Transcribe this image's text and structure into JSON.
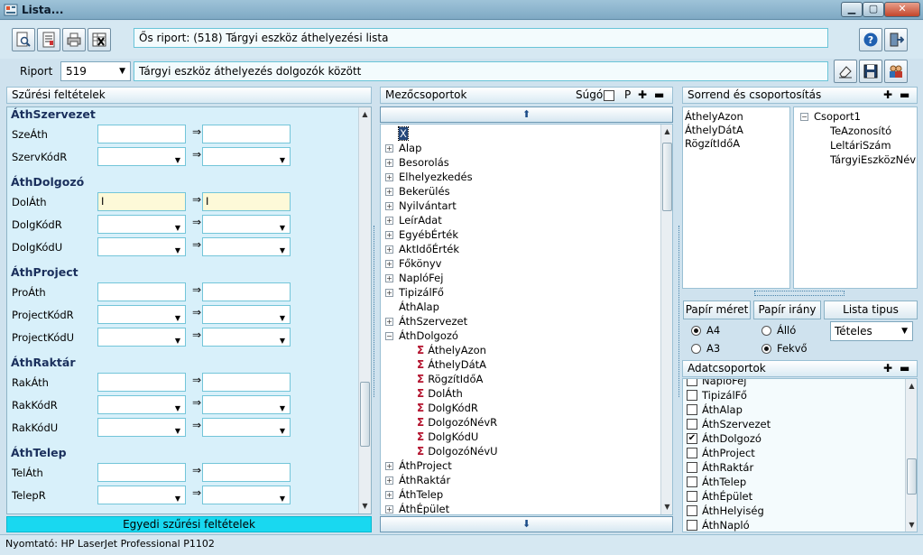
{
  "window": {
    "title": "Lista..."
  },
  "header": {
    "parent_report": "Ős riport: (518)  Tárgyi eszköz áthelyezési lista",
    "riport_label": "Riport",
    "riport_value": "519",
    "riport_desc": "Tárgyi eszköz áthelyezés dolgozók között"
  },
  "filter": {
    "title": "Szűrési feltételek",
    "footer_button": "Egyedi szűrési feltételek",
    "groups": [
      {
        "name": "ÁthSzervezet",
        "rows": [
          {
            "label": "SzeÁth",
            "type": "text",
            "from": "",
            "to": ""
          },
          {
            "label": "SzervKódR",
            "type": "select",
            "from": "",
            "to": ""
          }
        ]
      },
      {
        "name": "ÁthDolgozó",
        "rows": [
          {
            "label": "DolÁth",
            "type": "text",
            "from": "I",
            "to": "I"
          },
          {
            "label": "DolgKódR",
            "type": "select",
            "from": "",
            "to": ""
          },
          {
            "label": "DolgKódU",
            "type": "select",
            "from": "",
            "to": ""
          }
        ]
      },
      {
        "name": "ÁthProject",
        "rows": [
          {
            "label": "ProÁth",
            "type": "text",
            "from": "",
            "to": ""
          },
          {
            "label": "ProjectKódR",
            "type": "select",
            "from": "",
            "to": ""
          },
          {
            "label": "ProjectKódU",
            "type": "select",
            "from": "",
            "to": ""
          }
        ]
      },
      {
        "name": "ÁthRaktár",
        "rows": [
          {
            "label": "RakÁth",
            "type": "text",
            "from": "",
            "to": ""
          },
          {
            "label": "RakKódR",
            "type": "select",
            "from": "",
            "to": ""
          },
          {
            "label": "RakKódU",
            "type": "select",
            "from": "",
            "to": ""
          }
        ]
      },
      {
        "name": "ÁthTelep",
        "rows": [
          {
            "label": "TelÁth",
            "type": "text",
            "from": "",
            "to": ""
          },
          {
            "label": "TelepR",
            "type": "select",
            "from": "",
            "to": ""
          }
        ]
      }
    ]
  },
  "fields": {
    "title": "Mezőcsoportok",
    "help_label": "Súgó",
    "p_label": "P",
    "tree": [
      {
        "t": "X",
        "lvl": 0,
        "kind": "sel"
      },
      {
        "t": "Alap",
        "lvl": 0,
        "kind": "plus"
      },
      {
        "t": "Besorolás",
        "lvl": 0,
        "kind": "plus"
      },
      {
        "t": "Elhelyezkedés",
        "lvl": 0,
        "kind": "plus"
      },
      {
        "t": "Bekerülés",
        "lvl": 0,
        "kind": "plus"
      },
      {
        "t": "Nyilvántart",
        "lvl": 0,
        "kind": "plus"
      },
      {
        "t": "LeírAdat",
        "lvl": 0,
        "kind": "plus"
      },
      {
        "t": "EgyébÉrték",
        "lvl": 0,
        "kind": "plus"
      },
      {
        "t": "AktIdőÉrték",
        "lvl": 0,
        "kind": "plus"
      },
      {
        "t": "Főkönyv",
        "lvl": 0,
        "kind": "plus"
      },
      {
        "t": "NaplóFej",
        "lvl": 0,
        "kind": "plus"
      },
      {
        "t": "TipizálFő",
        "lvl": 0,
        "kind": "plus"
      },
      {
        "t": "ÁthAlap",
        "lvl": 0,
        "kind": "none"
      },
      {
        "t": "ÁthSzervezet",
        "lvl": 0,
        "kind": "plus"
      },
      {
        "t": "ÁthDolgozó",
        "lvl": 0,
        "kind": "minus"
      },
      {
        "t": "ÁthelyAzon",
        "lvl": 1,
        "kind": "sig"
      },
      {
        "t": "ÁthelyDátA",
        "lvl": 1,
        "kind": "sig"
      },
      {
        "t": "RögzítIdőA",
        "lvl": 1,
        "kind": "sig"
      },
      {
        "t": "DolÁth",
        "lvl": 1,
        "kind": "sig"
      },
      {
        "t": "DolgKódR",
        "lvl": 1,
        "kind": "sig"
      },
      {
        "t": "DolgozóNévR",
        "lvl": 1,
        "kind": "sig"
      },
      {
        "t": "DolgKódU",
        "lvl": 1,
        "kind": "sig"
      },
      {
        "t": "DolgozóNévU",
        "lvl": 1,
        "kind": "sig"
      },
      {
        "t": "ÁthProject",
        "lvl": 0,
        "kind": "plus"
      },
      {
        "t": "ÁthRaktár",
        "lvl": 0,
        "kind": "plus"
      },
      {
        "t": "ÁthTelep",
        "lvl": 0,
        "kind": "plus"
      },
      {
        "t": "ÁthÉpület",
        "lvl": 0,
        "kind": "plus"
      }
    ]
  },
  "order": {
    "title": "Sorrend és csoportosítás",
    "sort_list": [
      "ÁthelyAzon",
      "ÁthelyDátA",
      "RögzítIdőA"
    ],
    "group_root": "Csoport1",
    "group_items": [
      "TeAzonosító",
      "LeltáriSzám",
      "TárgyiEszközNév"
    ]
  },
  "paper": {
    "size_label": "Papír méret",
    "dir_label": "Papír irány",
    "list_type_label": "Lista tipus",
    "a4": "A4",
    "a3": "A3",
    "allo": "Álló",
    "fekvo": "Fekvő",
    "list_type_value": "Tételes",
    "selected_size": "A4",
    "selected_dir": "Fekvő"
  },
  "datagroups": {
    "title": "Adatcsoportok",
    "items": [
      {
        "t": "NaplóFej",
        "checked": false
      },
      {
        "t": "TipizálFő",
        "checked": false
      },
      {
        "t": "ÁthAlap",
        "checked": false
      },
      {
        "t": "ÁthSzervezet",
        "checked": false
      },
      {
        "t": "ÁthDolgozó",
        "checked": true
      },
      {
        "t": "ÁthProject",
        "checked": false
      },
      {
        "t": "ÁthRaktár",
        "checked": false
      },
      {
        "t": "ÁthTelep",
        "checked": false
      },
      {
        "t": "ÁthÉpület",
        "checked": false
      },
      {
        "t": "ÁthHelyiség",
        "checked": false
      },
      {
        "t": "ÁthNapló",
        "checked": false
      }
    ]
  },
  "status": {
    "printer": "Nyomtató: HP LaserJet Professional P1102"
  }
}
